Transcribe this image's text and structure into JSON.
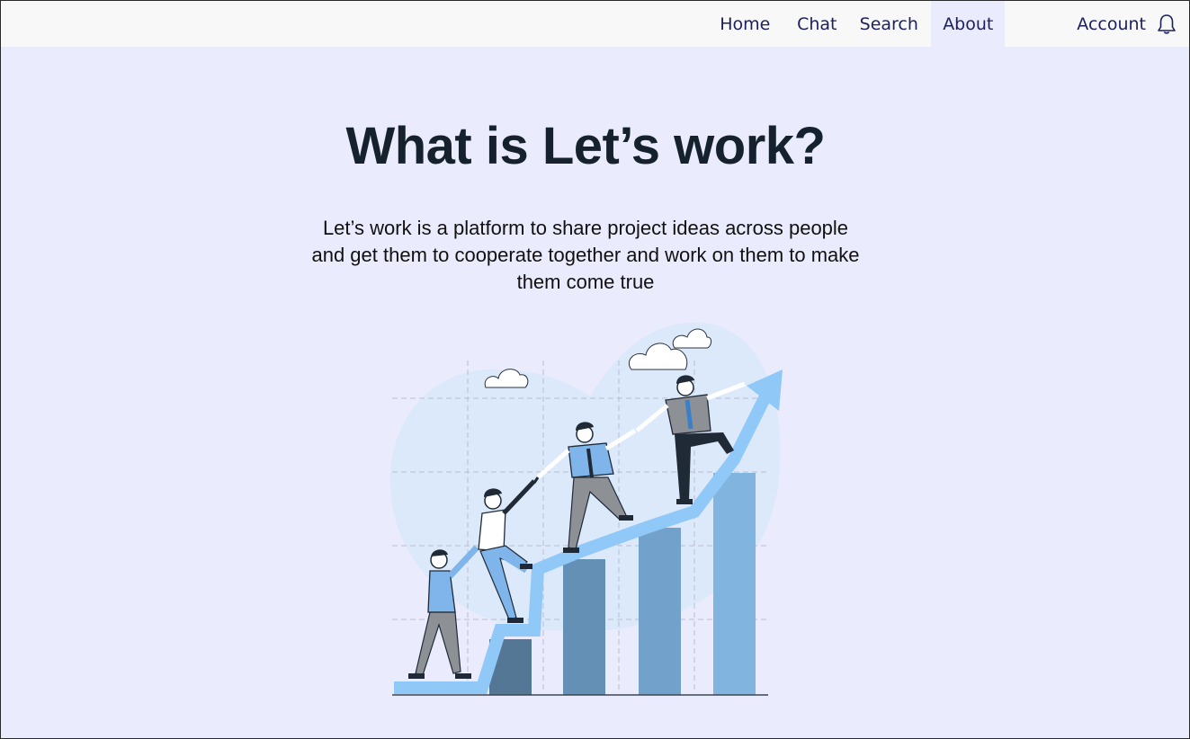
{
  "nav": {
    "items": [
      {
        "label": "Home"
      },
      {
        "label": "Chat"
      },
      {
        "label": "Search"
      },
      {
        "label": "About",
        "active": true
      }
    ],
    "account_label": "Account",
    "bell_icon": "bell-icon"
  },
  "hero": {
    "title": "What is Let’s work?",
    "description": "Let’s work is a platform to share project ideas across people and get them to cooperate together and work on them to make them come true"
  },
  "illustration": {
    "icon": "team-climbing-growth-chart-illustration"
  },
  "colors": {
    "page_bg": "#eaebfc",
    "topbar_bg": "#f8f8f8",
    "nav_text": "#1c1f5e",
    "title_text": "#15222e",
    "arrow": "#90c8f8"
  }
}
